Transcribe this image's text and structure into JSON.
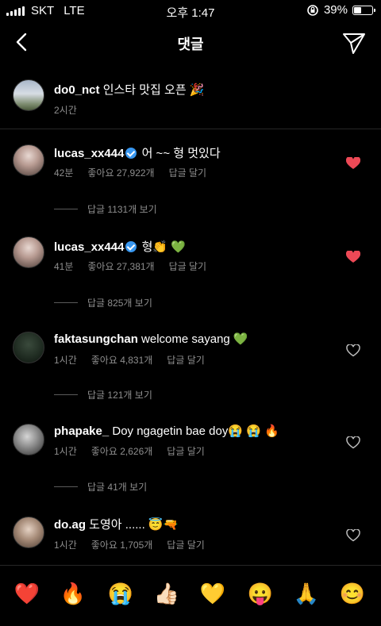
{
  "status_bar": {
    "carrier": "SKT",
    "network": "LTE",
    "time": "오후 1:47",
    "battery": "39%",
    "battery_level": 0.39
  },
  "header": {
    "title": "댓글",
    "back_icon": "chevron-left-icon",
    "send_icon": "paper-plane-icon"
  },
  "caption": {
    "username": "do0_nct",
    "text": "인스타 맛집 오픈 🎉",
    "time": "2시간"
  },
  "comments": [
    {
      "username": "lucas_xx444",
      "verified": true,
      "text": "어 ~~ 형 멋있다",
      "time": "42분",
      "likes": "좋아요 27,922개",
      "reply_label": "답글 달기",
      "view_replies": "답글 1131개 보기",
      "liked": true
    },
    {
      "username": "lucas_xx444",
      "verified": true,
      "text": "형👏 💚",
      "time": "41분",
      "likes": "좋아요 27,381개",
      "reply_label": "답글 달기",
      "view_replies": "답글 825개 보기",
      "liked": true
    },
    {
      "username": "faktasungchan",
      "verified": false,
      "text": "welcome sayang 💚",
      "time": "1시간",
      "likes": "좋아요 4,831개",
      "reply_label": "답글 달기",
      "view_replies": "답글 121개 보기",
      "liked": false
    },
    {
      "username": "phapake_",
      "verified": false,
      "text": "Doy ngagetin bae doy😭 😭 🔥",
      "time": "1시간",
      "likes": "좋아요 2,626개",
      "reply_label": "답글 달기",
      "view_replies": "답글 41개 보기",
      "liked": false
    },
    {
      "username": "do.ag",
      "verified": false,
      "text": "도영아 ...... 😇🔫",
      "time": "1시간",
      "likes": "좋아요 1,705개",
      "reply_label": "답글 달기",
      "liked": false
    }
  ],
  "quick_reactions": [
    "❤️",
    "🔥",
    "😭",
    "👍🏻",
    "💛",
    "😛",
    "🙏",
    "😊"
  ],
  "colors": {
    "heart_liked": "#ed4956",
    "verified": "#3897f0",
    "meta_text": "#8e8e8e"
  }
}
